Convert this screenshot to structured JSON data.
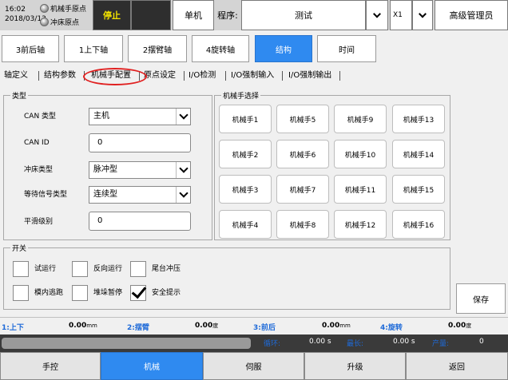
{
  "header": {
    "time": "16:02",
    "date": "2018/03/13",
    "status_items": [
      "机械手原点",
      "冲床原点"
    ],
    "run_state": "停止",
    "mode": "单机",
    "program_label": "程序:",
    "program_value": "测试",
    "axis_value": "X1",
    "user": "高级管理员"
  },
  "main_tabs": [
    {
      "label": "3前后轴"
    },
    {
      "label": "1上下轴"
    },
    {
      "label": "2摆臂轴"
    },
    {
      "label": "4旋转轴"
    },
    {
      "label": "结构",
      "active": true
    },
    {
      "label": "时间"
    }
  ],
  "sub_tabs": [
    {
      "label": "轴定义"
    },
    {
      "label": "结构参数"
    },
    {
      "label": "机械手配置",
      "active": true
    },
    {
      "label": "原点设定"
    },
    {
      "label": "I/O检测"
    },
    {
      "label": "I/O强制输入"
    },
    {
      "label": "I/O强制输出"
    }
  ],
  "type_group": {
    "title": "类型",
    "fields": [
      {
        "label": "CAN 类型",
        "kind": "select",
        "value": "主机"
      },
      {
        "label": "CAN ID",
        "kind": "text",
        "value": "0"
      },
      {
        "label": "冲床类型",
        "kind": "select",
        "value": "脉冲型"
      },
      {
        "label": "等待信号类型",
        "kind": "select",
        "value": "连续型"
      },
      {
        "label": "平滑级别",
        "kind": "text",
        "value": "0"
      }
    ]
  },
  "robot_group": {
    "title": "机械手选择",
    "buttons": [
      "机械手1",
      "机械手5",
      "机械手9",
      "机械手13",
      "机械手2",
      "机械手6",
      "机械手10",
      "机械手14",
      "机械手3",
      "机械手7",
      "机械手11",
      "机械手15",
      "机械手4",
      "机械手8",
      "机械手12",
      "机械手16"
    ]
  },
  "switch_group": {
    "title": "开关",
    "items": [
      {
        "label": "试运行",
        "checked": false
      },
      {
        "label": "反向运行",
        "checked": false
      },
      {
        "label": "尾台冲压",
        "checked": false
      },
      {
        "label": "模内逃跑",
        "checked": false
      },
      {
        "label": "堆垛暂停",
        "checked": false
      },
      {
        "label": "安全提示",
        "checked": true
      }
    ]
  },
  "save_label": "保存",
  "coords": [
    {
      "label": "1:上下",
      "value": "0.00",
      "unit": "mm"
    },
    {
      "label": "2:摆臂",
      "value": "0.00",
      "unit": "度"
    },
    {
      "label": "3:前后",
      "value": "0.00",
      "unit": "mm"
    },
    {
      "label": "4:旋转",
      "value": "0.00",
      "unit": "度"
    }
  ],
  "cycle": {
    "progress": 0,
    "loop_label": "循环:",
    "loop_value": "0.00 s",
    "max_label": "最长:",
    "max_value": "0.00 s",
    "output_label": "产量:",
    "output_value": "0"
  },
  "bottom_nav": [
    {
      "label": "手控"
    },
    {
      "label": "机械",
      "active": true
    },
    {
      "label": "伺服"
    },
    {
      "label": "升级"
    },
    {
      "label": "返回"
    }
  ],
  "colors": {
    "accent": "#2f8af0",
    "run_state_text": "#f2e200",
    "highlight_circle": "#e02020",
    "coord_label": "#1e6ad8"
  }
}
